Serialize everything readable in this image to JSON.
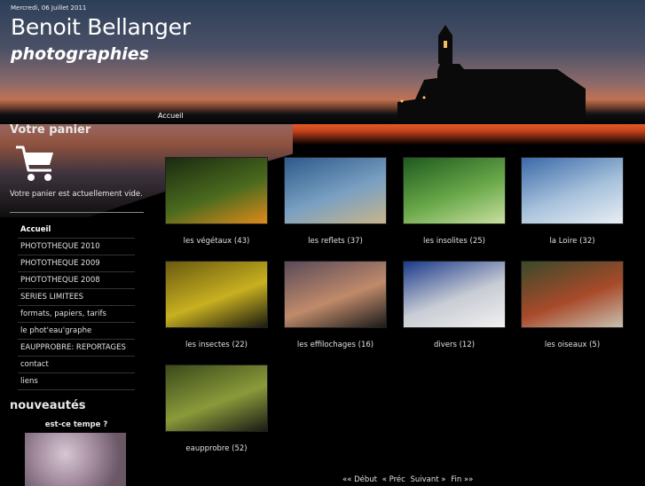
{
  "header": {
    "date": "Mercredi, 06 Juillet 2011",
    "title": "Benoit Bellanger",
    "subtitle": "photographies"
  },
  "breadcrumb": "Accueil",
  "cart": {
    "heading": "Votre panier",
    "icon": "cart-icon",
    "empty_text": "Votre panier est actuellement vide."
  },
  "menu": [
    "Accueil",
    "PHOTOTHEQUE 2010",
    "PHOTOTHEQUE 2009",
    "PHOTOTHEQUE 2008",
    "SERIES LIMITEES",
    "formats, papiers, tarifs",
    "le phot'eau'graphe",
    "EAUPPROBRE: REPORTAGES",
    "contact",
    "liens"
  ],
  "news": {
    "heading": "nouveautés",
    "item_title": "est-ce tempe ?"
  },
  "gallery": [
    {
      "label": "les végétaux (43)",
      "colors": [
        "#1b2a10",
        "#4a6a1e",
        "#e08a1a"
      ]
    },
    {
      "label": "les reflets (37)",
      "colors": [
        "#2d5a8a",
        "#7aa0c2",
        "#c7b58a"
      ]
    },
    {
      "label": "les insolites (25)",
      "colors": [
        "#1e5a1e",
        "#6aa84a",
        "#c8e0a0"
      ]
    },
    {
      "label": "la Loire (32)",
      "colors": [
        "#3a6aa8",
        "#a8c2dc",
        "#e8eef4"
      ]
    },
    {
      "label": "les insectes (22)",
      "colors": [
        "#6a5a10",
        "#c8b020",
        "#1a1a10"
      ]
    },
    {
      "label": "les effilochages (16)",
      "colors": [
        "#5a4a5a",
        "#c08a6a",
        "#1a1a1a"
      ]
    },
    {
      "label": "divers (12)",
      "colors": [
        "#1a3a8a",
        "#c8ccd4",
        "#f0f0f0"
      ]
    },
    {
      "label": "les oiseaux (5)",
      "colors": [
        "#3a4a2a",
        "#a84a2a",
        "#c8c0b0"
      ]
    },
    {
      "label": "eaupprobre (52)",
      "colors": [
        "#3a4a1a",
        "#8a9a3a",
        "#1a1a14"
      ]
    }
  ],
  "pager": {
    "first": "«« Début",
    "prev": "« Préc",
    "next": "Suivant »",
    "last": "Fin »»"
  }
}
